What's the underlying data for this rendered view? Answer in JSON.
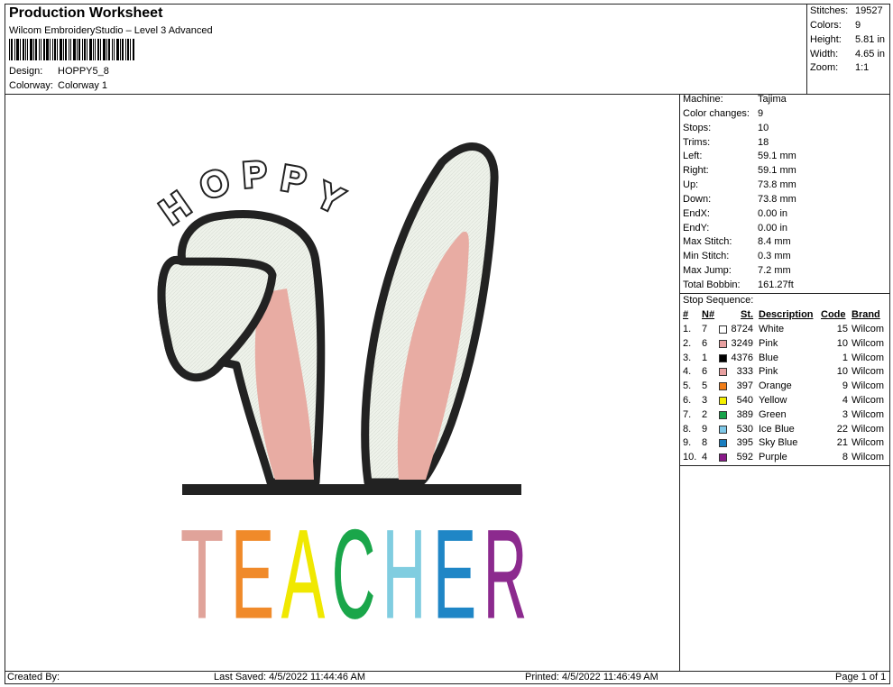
{
  "header": {
    "title": "Production Worksheet",
    "subtitle": "Wilcom EmbroideryStudio – Level 3 Advanced",
    "design_label": "Design:",
    "design_value": "HOPPY5_8",
    "colorway_label": "Colorway:",
    "colorway_value": "Colorway 1"
  },
  "stats": [
    {
      "key": "Stitches:",
      "value": "19527"
    },
    {
      "key": "Colors:",
      "value": "9"
    },
    {
      "key": "Height:",
      "value": "5.81 in"
    },
    {
      "key": "Width:",
      "value": "4.65 in"
    },
    {
      "key": "Zoom:",
      "value": "1:1"
    }
  ],
  "properties": [
    {
      "key": "Machine:",
      "value": "Tajima"
    },
    {
      "key": "Color changes:",
      "value": "9"
    },
    {
      "key": "Stops:",
      "value": "10"
    },
    {
      "key": "Trims:",
      "value": "18"
    },
    {
      "key": "Left:",
      "value": "59.1 mm"
    },
    {
      "key": "Right:",
      "value": "59.1 mm"
    },
    {
      "key": "Up:",
      "value": "73.8 mm"
    },
    {
      "key": "Down:",
      "value": "73.8 mm"
    },
    {
      "key": "EndX:",
      "value": "0.00 in"
    },
    {
      "key": "EndY:",
      "value": "0.00 in"
    },
    {
      "key": "Max Stitch:",
      "value": "8.4 mm"
    },
    {
      "key": "Min Stitch:",
      "value": "0.3 mm"
    },
    {
      "key": "Max Jump:",
      "value": "7.2 mm"
    },
    {
      "key": "Total Bobbin:",
      "value": "161.27ft"
    }
  ],
  "stop_sequence": {
    "label": "Stop Sequence:",
    "headers": {
      "num": "#",
      "n": "N#",
      "st": "St.",
      "desc": "Description",
      "code": "Code",
      "brand": "Brand"
    },
    "rows": [
      {
        "num": "1.",
        "n": "7",
        "color": "#ffffff",
        "st": "8724",
        "desc": "White",
        "code": "15",
        "brand": "Wilcom"
      },
      {
        "num": "2.",
        "n": "6",
        "color": "#e8a0a0",
        "st": "3249",
        "desc": "Pink",
        "code": "10",
        "brand": "Wilcom"
      },
      {
        "num": "3.",
        "n": "1",
        "color": "#000000",
        "st": "4376",
        "desc": "Blue",
        "code": "1",
        "brand": "Wilcom"
      },
      {
        "num": "4.",
        "n": "6",
        "color": "#e8a0a0",
        "st": "333",
        "desc": "Pink",
        "code": "10",
        "brand": "Wilcom"
      },
      {
        "num": "5.",
        "n": "5",
        "color": "#f07d18",
        "st": "397",
        "desc": "Orange",
        "code": "9",
        "brand": "Wilcom"
      },
      {
        "num": "6.",
        "n": "3",
        "color": "#f5f000",
        "st": "540",
        "desc": "Yellow",
        "code": "4",
        "brand": "Wilcom"
      },
      {
        "num": "7.",
        "n": "2",
        "color": "#17a34a",
        "st": "389",
        "desc": "Green",
        "code": "3",
        "brand": "Wilcom"
      },
      {
        "num": "8.",
        "n": "9",
        "color": "#7ec8e8",
        "st": "530",
        "desc": "Ice Blue",
        "code": "22",
        "brand": "Wilcom"
      },
      {
        "num": "9.",
        "n": "8",
        "color": "#1a7ec0",
        "st": "395",
        "desc": "Sky Blue",
        "code": "21",
        "brand": "Wilcom"
      },
      {
        "num": "10.",
        "n": "4",
        "color": "#8a1a8a",
        "st": "592",
        "desc": "Purple",
        "code": "8",
        "brand": "Wilcom"
      }
    ]
  },
  "design": {
    "top_text": "HOPPY",
    "bottom_letters": [
      {
        "ch": "T",
        "color": "#e0a39a"
      },
      {
        "ch": "E",
        "color": "#f08a2a"
      },
      {
        "ch": "A",
        "color": "#f0e800"
      },
      {
        "ch": "C",
        "color": "#1aa64a"
      },
      {
        "ch": "H",
        "color": "#80cde0"
      },
      {
        "ch": "E",
        "color": "#1f86c6"
      },
      {
        "ch": "R",
        "color": "#8c2a8e"
      }
    ]
  },
  "footer": {
    "created_by": "Created By:",
    "last_saved": "Last Saved: 4/5/2022 11:44:46 AM",
    "printed": "Printed: 4/5/2022 11:46:49 AM",
    "page": "Page 1 of 1"
  }
}
